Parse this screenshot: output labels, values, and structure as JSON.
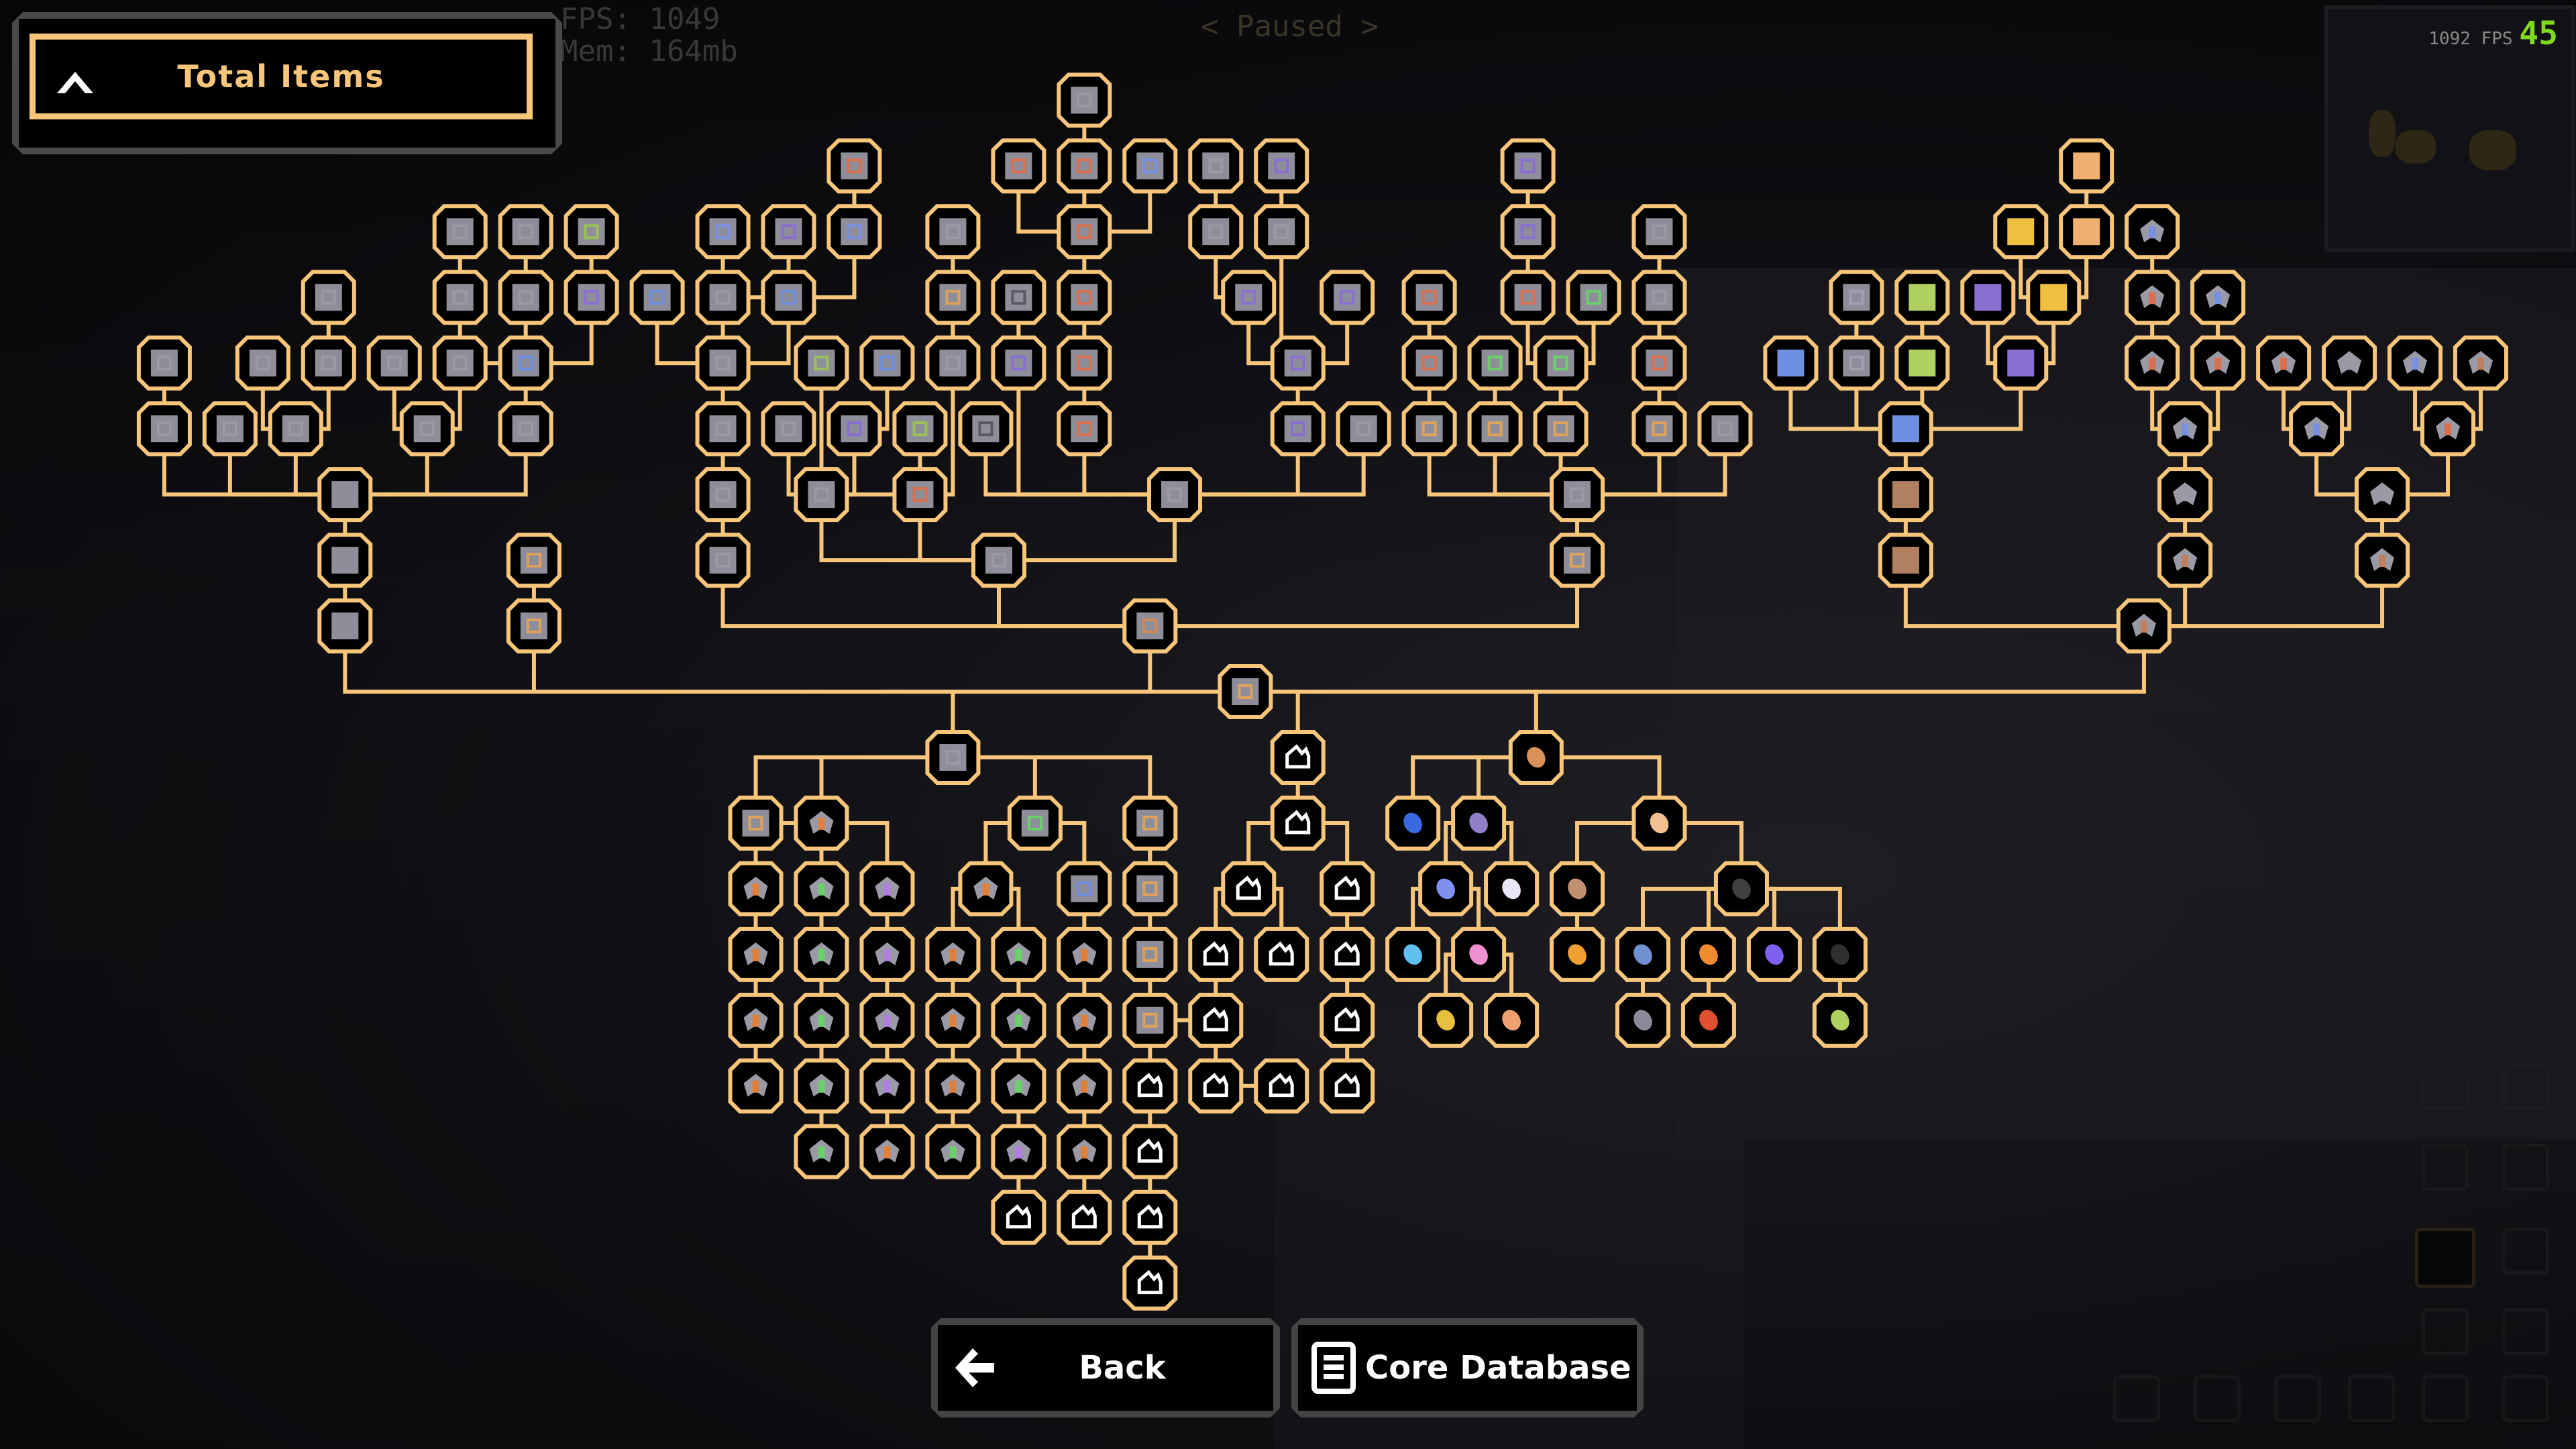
{
  "hud": {
    "fps": "FPS: 1049",
    "mem": "Mem: 164mb",
    "paused": "< Paused >",
    "fps_overlay_small": "1092 FPS",
    "fps_overlay_big": "45"
  },
  "header": {
    "title": "Total Items",
    "collapse_icon": "chevron-up-icon"
  },
  "buttons": {
    "back_label": "Back",
    "back_icon": "arrow-left-icon",
    "core_label": "Core Database",
    "core_icon": "database-icon"
  },
  "colors": {
    "accent": "#f7c67b",
    "node_fill": "#000000",
    "panel_border": "#4a4a4a",
    "fps_green": "#7fd91c"
  },
  "tree": {
    "root": "core",
    "nodes": [
      {
        "id": "core",
        "icon": "core-block",
        "tint": "#e0a25a"
      },
      {
        "id": "a1",
        "icon": "block-gray",
        "tint": "#8c8c96"
      },
      {
        "id": "a2",
        "icon": "block-gray",
        "tint": "#8c8c96"
      },
      {
        "id": "a3",
        "icon": "block-gray",
        "tint": "#8c8c96"
      },
      {
        "id": "a4a",
        "icon": "block-gray",
        "tint": "#9a9aa4"
      },
      {
        "id": "a4b",
        "icon": "block-gray",
        "tint": "#9a9aa4"
      },
      {
        "id": "a4c",
        "icon": "block-gray",
        "tint": "#9a9aa4"
      },
      {
        "id": "a4d",
        "icon": "block-gray",
        "tint": "#9a9aa4"
      },
      {
        "id": "a4e",
        "icon": "block-gray",
        "tint": "#9a9aa4"
      },
      {
        "id": "a5a",
        "icon": "block-gray",
        "tint": "#9a9aa4"
      },
      {
        "id": "a5c",
        "icon": "block-gray",
        "tint": "#9a9aa4"
      },
      {
        "id": "a5d",
        "icon": "block-gray",
        "tint": "#9a9aa4"
      },
      {
        "id": "a5e",
        "icon": "block-gray",
        "tint": "#9a9aa4"
      },
      {
        "id": "a5f",
        "icon": "block-gray",
        "tint": "#9a9aa4"
      },
      {
        "id": "a5g",
        "icon": "block-blue",
        "tint": "#6f8fe0"
      },
      {
        "id": "a6a",
        "icon": "block-gray",
        "tint": "#9a9aa4"
      },
      {
        "id": "a7a",
        "icon": "block-gray",
        "tint": "#9a9aa4"
      },
      {
        "id": "a7b",
        "icon": "block-gray",
        "tint": "#9a9aa4"
      },
      {
        "id": "a7c",
        "icon": "block-purple",
        "tint": "#8a6fd0"
      },
      {
        "id": "a8a",
        "icon": "block-gray",
        "tint": "#9a9aa4"
      },
      {
        "id": "a8b",
        "icon": "block-gray",
        "tint": "#9a9aa4"
      },
      {
        "id": "a8c",
        "icon": "block-green",
        "tint": "#9ac05a"
      },
      {
        "id": "b1",
        "icon": "block-orange",
        "tint": "#e0a25a"
      },
      {
        "id": "b2",
        "icon": "block-orange",
        "tint": "#e0a25a"
      },
      {
        "id": "c1",
        "icon": "block-orange",
        "tint": "#d08a5a"
      },
      {
        "id": "c2",
        "icon": "block-gray",
        "tint": "#9a9aa4"
      },
      {
        "id": "c3",
        "icon": "conveyor",
        "tint": "#9a9aa4"
      },
      {
        "id": "c4",
        "icon": "block-gray",
        "tint": "#9a9aa4"
      },
      {
        "id": "c5",
        "icon": "block-gray",
        "tint": "#9a9aa4"
      },
      {
        "id": "c6a",
        "icon": "block-blue",
        "tint": "#6f8fe0"
      },
      {
        "id": "c6b",
        "icon": "block-gray",
        "tint": "#9a9aa4"
      },
      {
        "id": "c6c",
        "icon": "conveyor-blue",
        "tint": "#6f8fe0"
      },
      {
        "id": "c7a",
        "icon": "block-blue",
        "tint": "#7a90e0"
      },
      {
        "id": "c7b",
        "icon": "conveyor-purple",
        "tint": "#8a6fd0"
      },
      {
        "id": "c7c",
        "icon": "block-blue",
        "tint": "#7a90e0"
      },
      {
        "id": "c8",
        "icon": "block-orange",
        "tint": "#d87050"
      },
      {
        "id": "d1",
        "icon": "block-gray",
        "tint": "#9a9aa4"
      },
      {
        "id": "d2a",
        "icon": "block-gray",
        "tint": "#9a9aa4"
      },
      {
        "id": "d2b",
        "icon": "block-orange",
        "tint": "#d87050"
      },
      {
        "id": "d3a",
        "icon": "block-gray",
        "tint": "#9a9aa4"
      },
      {
        "id": "d3b",
        "icon": "block-purple",
        "tint": "#8a6fd0"
      },
      {
        "id": "d3c",
        "icon": "block-blue",
        "tint": "#6f8fe0"
      },
      {
        "id": "d4a",
        "icon": "block-green",
        "tint": "#9ac05a"
      },
      {
        "id": "d4b",
        "icon": "block-gray",
        "tint": "#9a9aa4"
      },
      {
        "id": "d4c",
        "icon": "block-green",
        "tint": "#b0c060"
      },
      {
        "id": "d5a",
        "icon": "block-green",
        "tint": "#9ac05a"
      },
      {
        "id": "d5b",
        "icon": "block-gray",
        "tint": "#9a9aa4"
      },
      {
        "id": "d5c",
        "icon": "block-orange",
        "tint": "#e0a25a"
      },
      {
        "id": "d5d",
        "icon": "block-purple",
        "tint": "#8a6fd0"
      },
      {
        "id": "d6",
        "icon": "block-gray",
        "tint": "#9a9aa4"
      },
      {
        "id": "e1",
        "icon": "block-orange",
        "tint": "#d87050"
      },
      {
        "id": "e2",
        "icon": "block-orange",
        "tint": "#d87050"
      },
      {
        "id": "e3",
        "icon": "block-red",
        "tint": "#d87050"
      },
      {
        "id": "e4a",
        "icon": "block-orange",
        "tint": "#d87050"
      },
      {
        "id": "e4b",
        "icon": "block-orange",
        "tint": "#d87050"
      },
      {
        "id": "e4c",
        "icon": "block-blue",
        "tint": "#7a90e0"
      },
      {
        "id": "e5",
        "icon": "block-orange",
        "tint": "#d87050"
      },
      {
        "id": "e6",
        "icon": "block-gray",
        "tint": "#9a9aa4"
      },
      {
        "id": "f1",
        "icon": "block-dark",
        "tint": "#5a5a66"
      },
      {
        "id": "f2",
        "icon": "block-dark",
        "tint": "#5a5a66"
      },
      {
        "id": "f3",
        "icon": "block-purple",
        "tint": "#8a6fd0"
      },
      {
        "id": "f4",
        "icon": "block-purple",
        "tint": "#8a6fd0"
      },
      {
        "id": "f5",
        "icon": "block-purple",
        "tint": "#8a6fd0"
      },
      {
        "id": "f6",
        "icon": "block-gray",
        "tint": "#9a9aa4"
      },
      {
        "id": "f7",
        "icon": "block-purple",
        "tint": "#8a6fd0"
      },
      {
        "id": "f8",
        "icon": "block-gray",
        "tint": "#9a9aa4"
      },
      {
        "id": "f9",
        "icon": "block-purple",
        "tint": "#8a6fd0"
      },
      {
        "id": "f10",
        "icon": "block-gray",
        "tint": "#9a9aa4"
      },
      {
        "id": "g1",
        "icon": "block-gray",
        "tint": "#9a9aa4"
      },
      {
        "id": "g2",
        "icon": "block-orange",
        "tint": "#e0a25a"
      },
      {
        "id": "g3",
        "icon": "block-gray",
        "tint": "#9a9aa4"
      },
      {
        "id": "g4",
        "icon": "block-orange",
        "tint": "#e0a25a"
      },
      {
        "id": "g5",
        "icon": "block-orange",
        "tint": "#e0a25a"
      },
      {
        "id": "g6",
        "icon": "block-orange",
        "tint": "#e0a25a"
      },
      {
        "id": "g7",
        "icon": "block-green",
        "tint": "#6ad06a"
      },
      {
        "id": "g8",
        "icon": "block-green",
        "tint": "#6ad06a"
      },
      {
        "id": "g9",
        "icon": "block-green",
        "tint": "#6ad06a"
      },
      {
        "id": "g10",
        "icon": "block-orange",
        "tint": "#d87050"
      },
      {
        "id": "g11",
        "icon": "block-orange",
        "tint": "#d87050"
      },
      {
        "id": "g12",
        "icon": "block-orange",
        "tint": "#d87050"
      },
      {
        "id": "g13",
        "icon": "block-purple",
        "tint": "#8a6fd0"
      },
      {
        "id": "g14",
        "icon": "block-purple",
        "tint": "#8a6fd0"
      },
      {
        "id": "g15",
        "icon": "block-orange",
        "tint": "#e0a25a"
      },
      {
        "id": "g16",
        "icon": "block-orange",
        "tint": "#d87050"
      },
      {
        "id": "g17",
        "icon": "block-gray",
        "tint": "#9a9aa4"
      },
      {
        "id": "g18",
        "icon": "block-gray",
        "tint": "#9a9aa4"
      },
      {
        "id": "g19",
        "icon": "block-gray",
        "tint": "#9a9aa4"
      },
      {
        "id": "h1",
        "icon": "block-brown",
        "tint": "#b08060"
      },
      {
        "id": "h2",
        "icon": "block-brown",
        "tint": "#b08060"
      },
      {
        "id": "h3",
        "icon": "block-blue",
        "tint": "#6f8fe0"
      },
      {
        "id": "h4",
        "icon": "block-blue",
        "tint": "#6f8fe0"
      },
      {
        "id": "h5",
        "icon": "block-gray",
        "tint": "#a0a0b0"
      },
      {
        "id": "h6",
        "icon": "block-green",
        "tint": "#b0d060"
      },
      {
        "id": "h7",
        "icon": "block-purple",
        "tint": "#8a6fd0"
      },
      {
        "id": "h8",
        "icon": "block-gray",
        "tint": "#a0a0b0"
      },
      {
        "id": "h9",
        "icon": "block-green",
        "tint": "#b0d060"
      },
      {
        "id": "h10",
        "icon": "block-purple",
        "tint": "#8a6fd0"
      },
      {
        "id": "h11",
        "icon": "block-yellow",
        "tint": "#f0c040"
      },
      {
        "id": "h12",
        "icon": "block-yellow",
        "tint": "#f0c040"
      },
      {
        "id": "h13",
        "icon": "block-peach",
        "tint": "#f0b070"
      },
      {
        "id": "h14",
        "icon": "block-peach",
        "tint": "#f0b070"
      },
      {
        "id": "i1",
        "icon": "unit-naval",
        "tint": "#c08060"
      },
      {
        "id": "i2",
        "icon": "unit-naval",
        "tint": "#c08060"
      },
      {
        "id": "i3",
        "icon": "unit-naval",
        "tint": "#9a9aa4"
      },
      {
        "id": "i4",
        "icon": "unit-naval",
        "tint": "#7a90e0"
      },
      {
        "id": "i5",
        "icon": "unit-naval",
        "tint": "#d87050"
      },
      {
        "id": "i6",
        "icon": "unit-naval",
        "tint": "#d87050"
      },
      {
        "id": "i7",
        "icon": "unit-naval",
        "tint": "#d87050"
      },
      {
        "id": "i8",
        "icon": "unit-naval",
        "tint": "#7a90e0"
      },
      {
        "id": "i9",
        "icon": "unit-naval",
        "tint": "#7a90e0"
      },
      {
        "id": "i10",
        "icon": "unit-naval",
        "tint": "#c08060"
      },
      {
        "id": "i11",
        "icon": "unit-naval",
        "tint": "#9a9aa4"
      },
      {
        "id": "i12",
        "icon": "unit-naval",
        "tint": "#7a90e0"
      },
      {
        "id": "i13",
        "icon": "unit-naval",
        "tint": "#d87050"
      },
      {
        "id": "i14",
        "icon": "unit-naval",
        "tint": "#d87050"
      },
      {
        "id": "i15",
        "icon": "unit-naval",
        "tint": "#9a9aa4"
      },
      {
        "id": "i16",
        "icon": "unit-naval",
        "tint": "#7a90e0"
      },
      {
        "id": "i17",
        "icon": "unit-naval",
        "tint": "#c08060"
      },
      {
        "id": "j0",
        "icon": "factory-block",
        "tint": "#9a9aa4"
      },
      {
        "id": "j1",
        "icon": "factory-block",
        "tint": "#e0a25a"
      },
      {
        "id": "j2",
        "icon": "unit-ground",
        "tint": "#e0803a"
      },
      {
        "id": "j3",
        "icon": "factory-block",
        "tint": "#6ad06a"
      },
      {
        "id": "j4",
        "icon": "factory-block",
        "tint": "#e0a25a"
      },
      {
        "id": "k1",
        "icon": "unit-ground",
        "tint": "#e0803a"
      },
      {
        "id": "k2",
        "icon": "unit-ground",
        "tint": "#6ad06a"
      },
      {
        "id": "k3",
        "icon": "unit-ground",
        "tint": "#b080e0"
      },
      {
        "id": "k4",
        "icon": "unit-ground",
        "tint": "#e0803a"
      },
      {
        "id": "k5",
        "icon": "factory-block",
        "tint": "#6f8fe0"
      },
      {
        "id": "k6",
        "icon": "factory-block",
        "tint": "#e0a25a"
      },
      {
        "id": "k7",
        "icon": "unit-ground",
        "tint": "#e0803a"
      },
      {
        "id": "k8",
        "icon": "unit-ground",
        "tint": "#6ad06a"
      },
      {
        "id": "k9",
        "icon": "unit-ground",
        "tint": "#b080e0"
      },
      {
        "id": "k10",
        "icon": "unit-ground",
        "tint": "#e0803a"
      },
      {
        "id": "k11",
        "icon": "unit-ground",
        "tint": "#6ad06a"
      },
      {
        "id": "k12",
        "icon": "unit-ground",
        "tint": "#e0803a"
      },
      {
        "id": "k13",
        "icon": "factory-block",
        "tint": "#e0a25a"
      },
      {
        "id": "k14",
        "icon": "unit-ground",
        "tint": "#e0803a"
      },
      {
        "id": "k15",
        "icon": "unit-ground",
        "tint": "#6ad06a"
      },
      {
        "id": "k16",
        "icon": "unit-ground",
        "tint": "#b080e0"
      },
      {
        "id": "k17",
        "icon": "unit-ground",
        "tint": "#e0803a"
      },
      {
        "id": "k18",
        "icon": "unit-ground",
        "tint": "#6ad06a"
      },
      {
        "id": "k19",
        "icon": "unit-ground",
        "tint": "#e0803a"
      },
      {
        "id": "k20",
        "icon": "factory-block",
        "tint": "#e0a25a"
      },
      {
        "id": "k21",
        "icon": "unit-ground",
        "tint": "#e0803a"
      },
      {
        "id": "k22",
        "icon": "unit-ground",
        "tint": "#6ad06a"
      },
      {
        "id": "k23",
        "icon": "unit-ground",
        "tint": "#b080e0"
      },
      {
        "id": "k24",
        "icon": "unit-ground",
        "tint": "#e0803a"
      },
      {
        "id": "k25",
        "icon": "unit-ground",
        "tint": "#6ad06a"
      },
      {
        "id": "k26",
        "icon": "unit-ground",
        "tint": "#e0803a"
      },
      {
        "id": "k27",
        "icon": "unit-ground",
        "tint": "#6ad06a"
      },
      {
        "id": "k28",
        "icon": "unit-ground",
        "tint": "#e0803a"
      },
      {
        "id": "k29",
        "icon": "unit-ground",
        "tint": "#6ad06a"
      },
      {
        "id": "k30",
        "icon": "unit-ground",
        "tint": "#b080e0"
      },
      {
        "id": "k31",
        "icon": "unit-ground",
        "tint": "#e0803a"
      },
      {
        "id": "m1",
        "icon": "sector-locked",
        "tint": "#ffffff"
      },
      {
        "id": "m2",
        "icon": "sector-locked",
        "tint": "#ffffff"
      },
      {
        "id": "m3",
        "icon": "sector-locked",
        "tint": "#ffffff"
      },
      {
        "id": "m4",
        "icon": "sector-locked",
        "tint": "#ffffff"
      },
      {
        "id": "m5",
        "icon": "sector-locked",
        "tint": "#ffffff"
      },
      {
        "id": "m6",
        "icon": "sector-locked",
        "tint": "#ffffff"
      },
      {
        "id": "m7",
        "icon": "sector-locked",
        "tint": "#ffffff"
      },
      {
        "id": "m8",
        "icon": "sector-locked",
        "tint": "#ffffff"
      },
      {
        "id": "m9",
        "icon": "sector-locked",
        "tint": "#ffffff"
      },
      {
        "id": "m10",
        "icon": "sector-locked",
        "tint": "#ffffff"
      },
      {
        "id": "m11",
        "icon": "sector-locked",
        "tint": "#ffffff"
      },
      {
        "id": "m12",
        "icon": "sector-locked",
        "tint": "#ffffff"
      },
      {
        "id": "m13",
        "icon": "sector-locked",
        "tint": "#ffffff"
      },
      {
        "id": "m14",
        "icon": "sector-locked",
        "tint": "#ffffff"
      },
      {
        "id": "m15",
        "icon": "sector-locked",
        "tint": "#ffffff"
      },
      {
        "id": "n1",
        "icon": "item-copper",
        "tint": "#d9905a"
      },
      {
        "id": "n2",
        "icon": "liquid-water",
        "tint": "#3a6ae0"
      },
      {
        "id": "n3",
        "icon": "item-lead",
        "tint": "#9080c8"
      },
      {
        "id": "n4",
        "icon": "item-titanium",
        "tint": "#8090f0"
      },
      {
        "id": "n5",
        "icon": "item-metaglass",
        "tint": "#e8e8f8"
      },
      {
        "id": "n6",
        "icon": "liquid-cryofluid",
        "tint": "#60c0f0"
      },
      {
        "id": "n7",
        "icon": "item-spore-pod",
        "tint": "#f090d0"
      },
      {
        "id": "n8",
        "icon": "item-surge-alloy",
        "tint": "#e8c040"
      },
      {
        "id": "n9",
        "icon": "item-plastanium",
        "tint": "#f0a070"
      },
      {
        "id": "n10",
        "icon": "item-sand",
        "tint": "#f0c090"
      },
      {
        "id": "n11",
        "icon": "item-scrap",
        "tint": "#c09070"
      },
      {
        "id": "n12",
        "icon": "liquid-slag",
        "tint": "#f0a030"
      },
      {
        "id": "n13",
        "icon": "item-coal",
        "tint": "#404040"
      },
      {
        "id": "n14",
        "icon": "item-silicon",
        "tint": "#7090d0"
      },
      {
        "id": "n15",
        "icon": "item-pyratite",
        "tint": "#f08a30"
      },
      {
        "id": "n16",
        "icon": "item-phase-fabric",
        "tint": "#8060f0"
      },
      {
        "id": "n17",
        "icon": "liquid-oil",
        "tint": "#303030"
      },
      {
        "id": "n18",
        "icon": "item-graphite",
        "tint": "#8a8a98"
      },
      {
        "id": "n19",
        "icon": "item-blast-compound",
        "tint": "#e05030"
      },
      {
        "id": "n20",
        "icon": "item-thorium",
        "tint": "#b0d060"
      }
    ]
  },
  "sidebar": {
    "selected_icon": "power-icon",
    "icons": [
      "turret-icon",
      "production-icon",
      "distribution-icon",
      "liquid-icon",
      "power-icon",
      "defense-icon",
      "crafting-icon",
      "units-icon",
      "effect-icon",
      "logic-icon",
      "map-icon",
      "core-icon",
      "chip-icon"
    ]
  }
}
